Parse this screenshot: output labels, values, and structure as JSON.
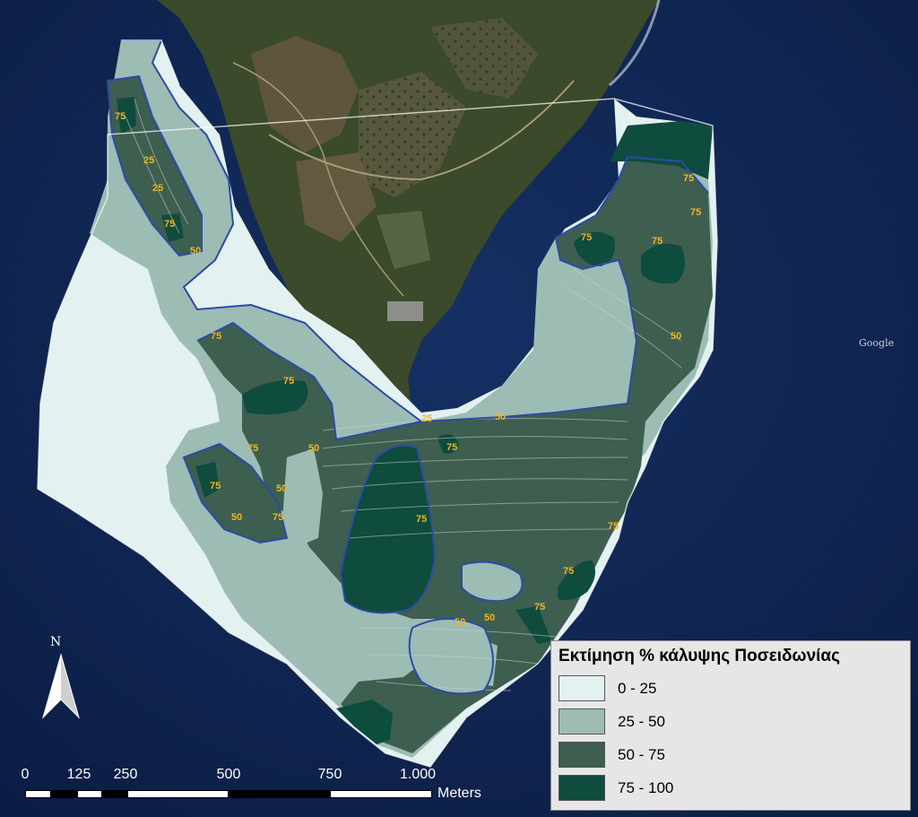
{
  "legend": {
    "title": "Εκτίμηση % κάλυψης Ποσειδωνίας",
    "classes": [
      {
        "label": "0 - 25",
        "color": "#e3f1f1"
      },
      {
        "label": "25 - 50",
        "color": "#9dbcb4"
      },
      {
        "label": "50 - 75",
        "color": "#3e5e4f"
      },
      {
        "label": "75 - 100",
        "color": "#0e4c3e"
      }
    ]
  },
  "north": {
    "label": "N"
  },
  "scale": {
    "ticks": [
      "0",
      "125",
      "250",
      "500",
      "750",
      "1.000"
    ],
    "units": "Meters"
  },
  "basemap": {
    "attribution": "Google"
  },
  "contour_labels": [
    "75",
    "75",
    "75",
    "75",
    "75",
    "75",
    "75",
    "75",
    "75",
    "75",
    "75",
    "75",
    "75",
    "75",
    "75",
    "75",
    "50",
    "50",
    "50",
    "50",
    "50",
    "50",
    "50",
    "50",
    "25",
    "25",
    "25"
  ],
  "colors": {
    "sea": "#0f2654",
    "land": "#3d4a2c",
    "contour": "#2c4aa8",
    "label": "#f2b51f"
  }
}
